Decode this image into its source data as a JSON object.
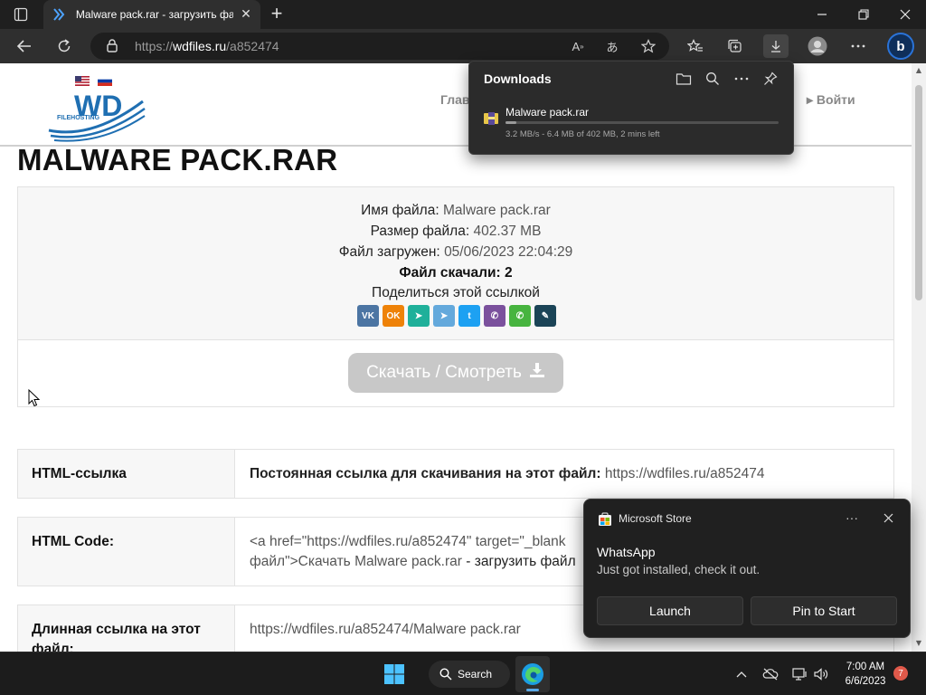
{
  "browser": {
    "tab_title": "Malware pack.rar - загрузить фа",
    "url_prefix": "https://",
    "url_host": "wdfiles.ru",
    "url_path": "/a852474"
  },
  "site": {
    "logo_text": "WD",
    "logo_sub": "FILEHOSTING",
    "nav_home": "Глав",
    "nav_login": "▸ Войти"
  },
  "file": {
    "heading": "MALWARE PACK.RAR",
    "name_label": "Имя файла:",
    "name_value": "Malware pack.rar",
    "size_label": "Размер файла:",
    "size_value": "402.37 MB",
    "uploaded_label": "Файл загружен:",
    "uploaded_value": "05/06/2023 22:04:29",
    "downloads_text": "Файл скачали: 2",
    "share_text": "Поделиться этой ссылкой",
    "download_button": "Скачать / Смотреть"
  },
  "share_buttons": [
    {
      "name": "vk",
      "glyph": "VK",
      "color": "#4c75a3"
    },
    {
      "name": "odnoklassniki",
      "glyph": "OK",
      "color": "#ee8208"
    },
    {
      "name": "yandex-messenger",
      "glyph": "➤",
      "color": "#1fb09a"
    },
    {
      "name": "telegram",
      "glyph": "➤",
      "color": "#64a9dc"
    },
    {
      "name": "twitter",
      "glyph": "t",
      "color": "#1da1f2"
    },
    {
      "name": "viber",
      "glyph": "✆",
      "color": "#7b519d"
    },
    {
      "name": "whatsapp",
      "glyph": "✆",
      "color": "#47b43f"
    },
    {
      "name": "livejournal",
      "glyph": "✎",
      "color": "#1b4457"
    }
  ],
  "links": {
    "row1_label": "HTML-ссылка",
    "row1_prefix": "Постоянная ссылка для скачивания на этот файл:",
    "row1_url": "https://wdfiles.ru/a852474",
    "row2_label": "HTML Code:",
    "row2_line1": "<a href=\"https://wdfiles.ru/a852474\" target=\"_blank",
    "row2_line2a": "файл\">Скачать ",
    "row2_line2b": "Malware pack.rar",
    "row2_line2c": " - загрузить файл",
    "row3_label": "Длинная ссылка на этот файл:",
    "row3_url": "https://wdfiles.ru/a852474/Malware pack.rar"
  },
  "downloads_panel": {
    "title": "Downloads",
    "file_name": "Malware pack.rar",
    "status": "3.2 MB/s - 6.4 MB of 402 MB, 2 mins left",
    "progress_fraction": 0.016
  },
  "toast": {
    "app": "Microsoft Store",
    "more": "···",
    "title": "WhatsApp",
    "message": "Just got installed, check it out.",
    "launch": "Launch",
    "pin": "Pin to Start"
  },
  "taskbar": {
    "search_label": "Search",
    "time": "7:00 AM",
    "date": "6/6/2023",
    "notifications": "7"
  }
}
